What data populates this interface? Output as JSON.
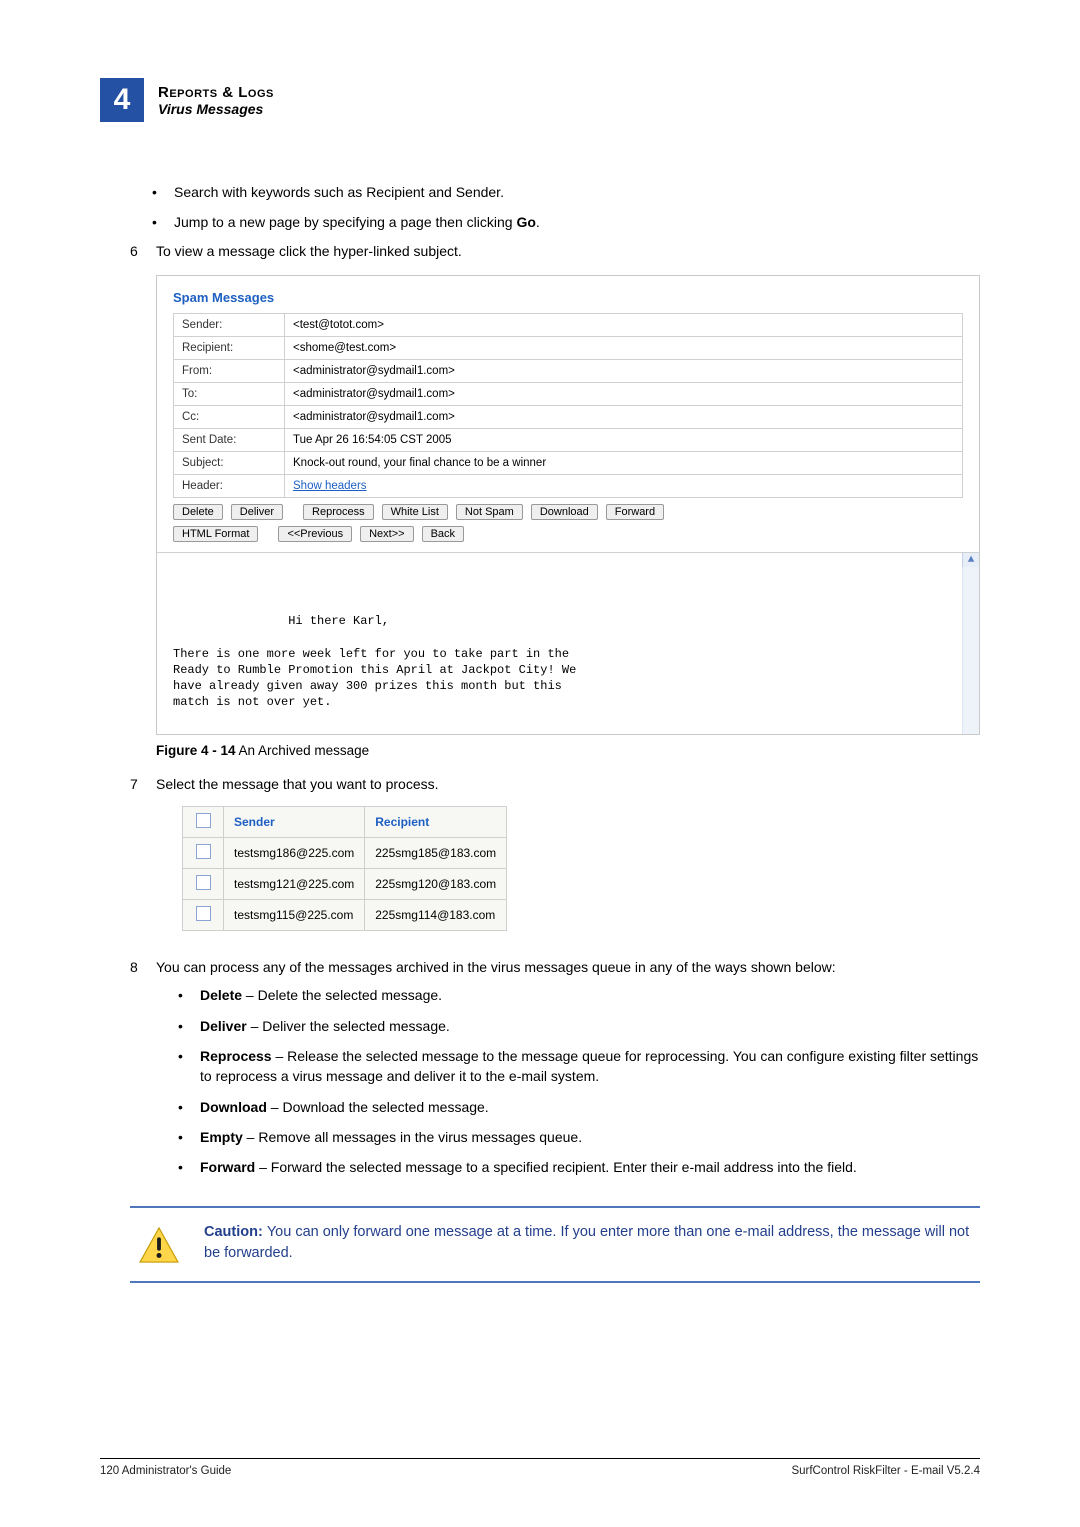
{
  "header": {
    "chapter_number": "4",
    "title": "Reports & Logs",
    "subtitle": "Virus Messages"
  },
  "intro_bullets": [
    {
      "pre": "Search with keywords such as Recipient and Sender."
    },
    {
      "pre": "Jump to a new page by specifying a page then clicking ",
      "bold": "Go",
      "post": "."
    }
  ],
  "steps": {
    "step6": {
      "num": "6",
      "text": "To view a message click the hyper-linked subject."
    },
    "step7": {
      "num": "7",
      "text": "Select the message that you want to process."
    },
    "step8": {
      "num": "8",
      "text": "You can process any of the messages archived in the virus messages queue in any of the ways shown below:"
    }
  },
  "spam_panel": {
    "title": "Spam Messages",
    "rows": {
      "sender_label": "Sender:",
      "sender_val": "<test@totot.com>",
      "recipient_label": "Recipient:",
      "recipient_val": "<shome@test.com>",
      "from_label": "From:",
      "from_val": "<administrator@sydmail1.com>",
      "to_label": "To:",
      "to_val": "<administrator@sydmail1.com>",
      "cc_label": "Cc:",
      "cc_val": "<administrator@sydmail1.com>",
      "sentdate_label": "Sent Date:",
      "sentdate_val": "Tue Apr 26 16:54:05 CST 2005",
      "subject_label": "Subject:",
      "subject_val": "Knock-out round, your final chance to be a winner",
      "header_label": "Header:",
      "header_link": "Show headers"
    },
    "buttons": {
      "delete": "Delete",
      "deliver": "Deliver",
      "reprocess": "Reprocess",
      "whitelist": "White List",
      "notspam": "Not Spam",
      "download": "Download",
      "forward": "Forward",
      "htmlformat": "HTML Format",
      "prev": "<<Previous",
      "next": "Next>>",
      "back": "Back"
    },
    "preview_text": "Hi there Karl,\n\nThere is one more week left for you to take part in the\nReady to Rumble Promotion this April at Jackpot City! We\nhave already given away 300 prizes this month but this\nmatch is not over yet."
  },
  "figcaption": {
    "bold": "Figure 4 - 14",
    "rest": " An Archived message"
  },
  "sel_table": {
    "headers": {
      "sender": "Sender",
      "recipient": "Recipient"
    },
    "rows": [
      {
        "sender": "testsmg186@225.com",
        "recipient": "225smg185@183.com"
      },
      {
        "sender": "testsmg121@225.com",
        "recipient": "225smg120@183.com"
      },
      {
        "sender": "testsmg115@225.com",
        "recipient": "225smg114@183.com"
      }
    ]
  },
  "actions": [
    {
      "name": "Delete",
      "desc": " – Delete the selected message."
    },
    {
      "name": "Deliver",
      "desc": " – Deliver the selected message."
    },
    {
      "name": "Reprocess",
      "desc": " – Release the selected message to the message queue for reprocessing. You can configure existing filter settings to reprocess a virus message and deliver it to the e-mail system."
    },
    {
      "name": "Download",
      "desc": " – Download the selected message."
    },
    {
      "name": "Empty",
      "desc": " – Remove all messages in the virus messages queue."
    },
    {
      "name": "Forward",
      "desc": " – Forward the selected message to a specified recipient. Enter their e-mail address into the field."
    }
  ],
  "caution": {
    "label": "Caution:  ",
    "text": "You can only forward one message at a time. If you enter more than one e-mail address, the message will not be forwarded."
  },
  "footer": {
    "left_page": "120",
    "left_text": "  Administrator's Guide",
    "right": "SurfControl RiskFilter - E-mail V5.2.4"
  }
}
